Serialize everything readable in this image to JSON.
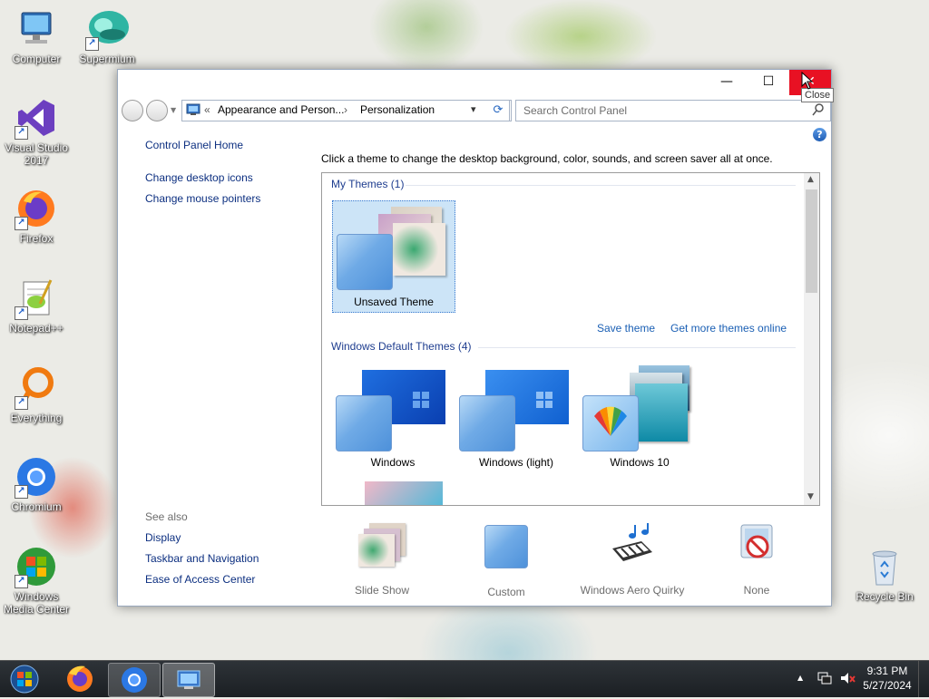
{
  "desktop": {
    "icons": [
      {
        "label": "Computer",
        "icon": "computer-icon",
        "shortcut": false
      },
      {
        "label": "Supermium",
        "icon": "supermium-icon",
        "shortcut": true
      },
      {
        "label": "Visual Studio 2017",
        "icon": "visual-studio-icon",
        "shortcut": true
      },
      {
        "label": "Firefox",
        "icon": "firefox-icon",
        "shortcut": true
      },
      {
        "label": "Notepad++",
        "icon": "notepad-plus-plus-icon",
        "shortcut": true
      },
      {
        "label": "Everything",
        "icon": "everything-search-icon",
        "shortcut": true
      },
      {
        "label": "Chromium",
        "icon": "chromium-icon",
        "shortcut": true
      },
      {
        "label": "Windows Media Center",
        "icon": "windows-media-center-icon",
        "shortcut": true
      },
      {
        "label": "Recycle Bin",
        "icon": "recycle-bin-icon",
        "shortcut": false
      }
    ]
  },
  "window": {
    "minimize_glyph": "—",
    "maximize_glyph": "☐",
    "close_glyph": "✕",
    "close_tooltip": "Close",
    "address": {
      "chevrons": "«",
      "crumb1": "Appearance and Person...",
      "separator": "›",
      "crumb2": "Personalization",
      "dropdown": "▾"
    },
    "refresh_glyph": "⟳",
    "search": {
      "placeholder": "Search Control Panel",
      "icon": "search-icon"
    },
    "help_glyph": "?",
    "sidebar": {
      "home": "Control Panel Home",
      "links": [
        "Change desktop icons",
        "Change mouse pointers"
      ],
      "see_also_title": "See also",
      "see_also": [
        "Display",
        "Taskbar and Navigation",
        "Ease of Access Center"
      ]
    },
    "instruction": "Click a theme to change the desktop background, color, sounds, and screen saver all at once.",
    "my_themes": {
      "heading": "My Themes (1)",
      "items": [
        {
          "label": "Unsaved Theme",
          "selected": true
        }
      ],
      "save_link": "Save theme",
      "more_link": "Get more themes online"
    },
    "default_themes": {
      "heading": "Windows Default Themes (4)",
      "items": [
        {
          "label": "Windows"
        },
        {
          "label": "Windows (light)"
        },
        {
          "label": "Windows 10"
        }
      ]
    },
    "bottom_bar": [
      {
        "label": "Slide Show",
        "icon": "slideshow-icon"
      },
      {
        "label": "Custom",
        "icon": "window-color-icon"
      },
      {
        "label": "Windows Aero Quirky",
        "icon": "sound-piano-icon"
      },
      {
        "label": "None",
        "icon": "no-screensaver-icon"
      }
    ],
    "colors": {
      "close_red": "#e81123",
      "link_blue": "#1a5fb4",
      "heading_blue": "#1e3d8f",
      "selection": "#cce4f7"
    }
  },
  "taskbar": {
    "time": "9:31 PM",
    "date": "5/27/2024",
    "apps": [
      "start-orb-icon",
      "firefox-icon",
      "chromium-icon",
      "control-panel-icon"
    ],
    "tray_up": "▲"
  }
}
